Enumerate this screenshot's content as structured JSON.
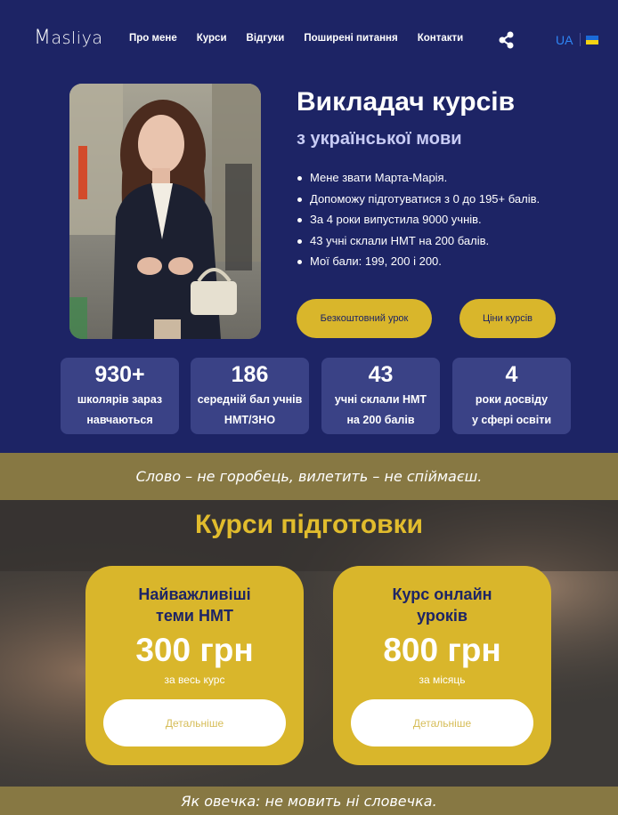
{
  "header": {
    "logo": "Masliya",
    "logo_first": "M",
    "logo_rest": "asliya",
    "nav": [
      "Про мене",
      "Курси",
      "Відгуки",
      "Поширені питання",
      "Контакти"
    ],
    "share_icon": "share-icon",
    "lang": "UA",
    "flag_colors": [
      "#1a6ad8",
      "#f5d313"
    ]
  },
  "hero": {
    "title": "Викладач курсів",
    "subtitle": "з української мови",
    "bullets": [
      "Мене звати Марта-Марія.",
      "Допоможу підготуватися з 0 до 195+ балів.",
      "За 4 роки випустила 9000 учнів.",
      "43 учні склали НМТ на 200 балів.",
      "Мої бали: 199, 200 і 200."
    ],
    "btn_free": "Безкоштовний урок",
    "btn_prices": "Ціни курсів"
  },
  "stats": [
    {
      "value": "930+",
      "label": "школярів зараз\nнавчаються"
    },
    {
      "value": "186",
      "label": "середній бал учнів\nНМТ/ЗНО"
    },
    {
      "value": "43",
      "label": "учні склали НМТ\nна 200 балів"
    },
    {
      "value": "4",
      "label": "роки досвіду\nу сфері освіти"
    }
  ],
  "quote1": "Слово – не горобець, вилетить – не спіймаєш.",
  "courses": {
    "title": "Курси підготовки",
    "cards": [
      {
        "title": "Найважливіші\nтеми НМТ",
        "price": "300 грн",
        "period": "за весь курс",
        "button": "Детальніше"
      },
      {
        "title": "Курс онлайн\nуроків",
        "price": "800 грн",
        "period": "за місяць",
        "button": "Детальніше"
      }
    ]
  },
  "quote2": "Як овечка: не мовить ні словечка.",
  "colors": {
    "navy": "#1d2465",
    "gold": "#d9b62b",
    "olive_band": "#877843",
    "stat_card": "#3a4286",
    "link_blue": "#2f86f6"
  }
}
